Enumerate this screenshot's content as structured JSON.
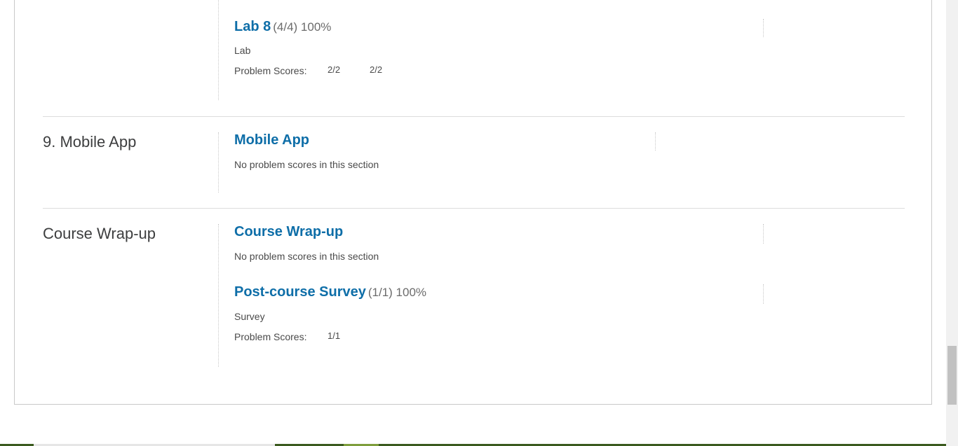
{
  "lab8": {
    "title": "Lab 8",
    "score": "(4/4) 100%",
    "type": "Lab",
    "problem_scores_label": "Problem Scores:",
    "scores": [
      "2/2",
      "2/2"
    ]
  },
  "chapter9": {
    "title": "9. Mobile App",
    "section_title": "Mobile App",
    "note": "No problem scores in this section"
  },
  "wrapup": {
    "title": "Course Wrap-up",
    "section_title": "Course Wrap-up",
    "note": "No problem scores in this section",
    "survey": {
      "title": "Post-course Survey",
      "score": "(1/1) 100%",
      "type": "Survey",
      "problem_scores_label": "Problem Scores:",
      "scores": [
        "1/1"
      ]
    }
  }
}
